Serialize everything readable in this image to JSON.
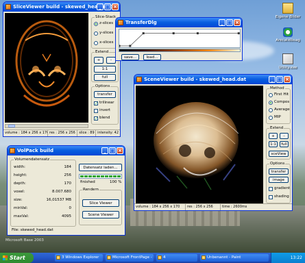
{
  "desktop": {
    "icons": [
      {
        "label": "Eigene Bilder"
      },
      {
        "label": "Arecalidbsag"
      },
      {
        "label": "Utility.exe"
      }
    ],
    "watermark": "Microsoft Base 2003"
  },
  "slice_viewer": {
    "title": "SliceViewer build - skewed_head.dat",
    "slice_stack_title": "Slice-Stack",
    "slice_options": [
      "z-slices",
      "y-slices",
      "x-slices"
    ],
    "selected_slice": "z-slices",
    "extend_title": "Extend",
    "plus_label": "+",
    "minus_label": "-",
    "ratio_label": "1:1",
    "full_label": "full",
    "options_title": "Options",
    "transfer_label": "transfer",
    "trilinear_label": "trilinear",
    "trilinear_checked": true,
    "invert_label": "invert",
    "invert_checked": false,
    "blend_label": "blend",
    "blend_checked": true,
    "status": {
      "volume": "volume : 184 x 256 x 170",
      "res": "res : 256 x 256",
      "slice": "slice : 89",
      "intensity": "intensity: 42"
    }
  },
  "transfer_dlg": {
    "title": "TransferDlg",
    "save_label": "save...",
    "load_label": "load...",
    "curve_points": [
      [
        0,
        0.0
      ],
      [
        0.09,
        0.0
      ],
      [
        0.2,
        0.92
      ],
      [
        0.45,
        0.92
      ],
      [
        0.65,
        0.92
      ],
      [
        0.99,
        0.92
      ]
    ]
  },
  "scene_viewer": {
    "title": "SceneViewer build - skewed_head.dat",
    "method_title": "Method",
    "methods": [
      "First Hit",
      "Compos",
      "Average",
      "MIP"
    ],
    "selected_method": "Compos",
    "extend_title": "Extend",
    "plus_label": "+",
    "minus_label": "-",
    "ratio_label": "1:1",
    "full_label": "full",
    "view_label": "sceView",
    "options_title": "Options",
    "transfer_label": "transfer",
    "image_label": "image",
    "gradient_label": "gradient",
    "gradient_checked": false,
    "shading_label": "shading",
    "shading_checked": false,
    "status": {
      "volume": "volume : 184 x 256 x 170",
      "res": "res : 256 x 256",
      "time": "time : 2600ms"
    }
  },
  "vol_pack": {
    "title": "VolPack build",
    "group_title": "Volumendatensatz",
    "fields": [
      {
        "label": "width:",
        "value": "184"
      },
      {
        "label": "height:",
        "value": "256"
      },
      {
        "label": "depth:",
        "value": "170"
      },
      {
        "label": "voxel:",
        "value": "8.007.680"
      },
      {
        "label": "size:",
        "value": "16,01537 MB"
      },
      {
        "label": "minVal:",
        "value": "0"
      },
      {
        "label": "maxVal:",
        "value": "4095"
      }
    ],
    "load_button": "Datensatz laden...",
    "progress_percent": 100,
    "progress_label": "finished",
    "progress_text": "100 %",
    "render_title": "Rendern",
    "slice_viewer_button": "Slice Viewer",
    "scene_viewer_button": "Scene Viewer",
    "file_label": "File: skewed_head.dat"
  },
  "taskbar": {
    "start_label": "Start",
    "tasks": [
      {
        "label": "3 Windows Explorer"
      },
      {
        "label": "Microsoft FrontPage -"
      },
      {
        "label": "4"
      },
      {
        "label": "Unbenannt - Paint"
      }
    ],
    "clock": "13:22"
  }
}
